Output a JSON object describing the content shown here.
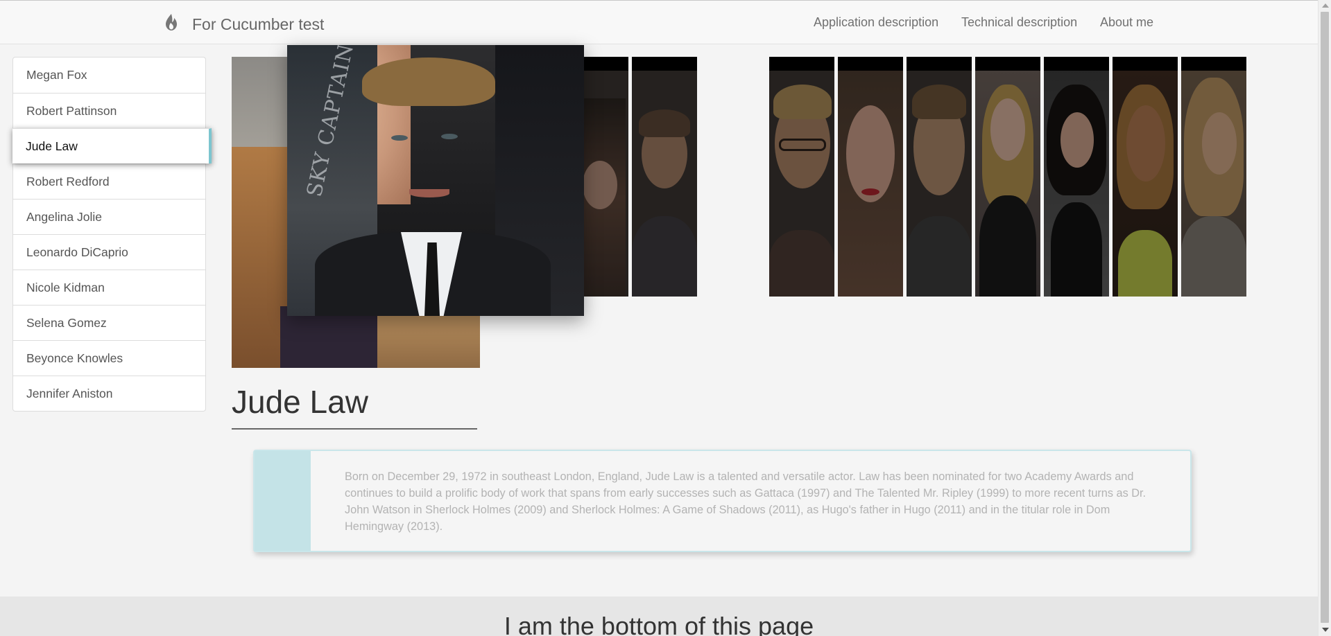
{
  "navbar": {
    "brand": "For Cucumber test",
    "brand_icon": "flame-icon",
    "links": [
      "Application description",
      "Technical description",
      "About me"
    ]
  },
  "sidebar": {
    "items": [
      {
        "label": "Megan Fox"
      },
      {
        "label": "Robert Pattinson"
      },
      {
        "label": "Jude Law",
        "active": true
      },
      {
        "label": "Robert Redford"
      },
      {
        "label": "Angelina Jolie"
      },
      {
        "label": "Leonardo DiCaprio"
      },
      {
        "label": "Nicole Kidman"
      },
      {
        "label": "Selena Gomez"
      },
      {
        "label": "Beyonce Knowles"
      },
      {
        "label": "Jennifer Aniston"
      }
    ]
  },
  "main": {
    "title": "Jude Law",
    "description": "Born on December 29, 1972 in southeast London, England, Jude Law is a talented and versatile actor. Law has been nominated for two Academy Awards and continues to build a prolific body of work that spans from early successes such as Gattaca (1997) and The Talented Mr. Ripley (1999) to more recent turns as Dr. John Watson in Sherlock Holmes (2009) and Sherlock Holmes: A Game of Shadows (2011), as Hugo's father in Hugo (2011) and in the titular role in Dom Hemingway (2013).",
    "hover_photo_sign": "SKY CAPTAIN"
  },
  "footer": {
    "text": "I am the bottom of this page"
  },
  "colors": {
    "accent": "#7cc5cf",
    "desc_accent": "#c4e3e7",
    "navbar_bg": "#f8f8f8",
    "page_bg": "#f4f4f4"
  }
}
